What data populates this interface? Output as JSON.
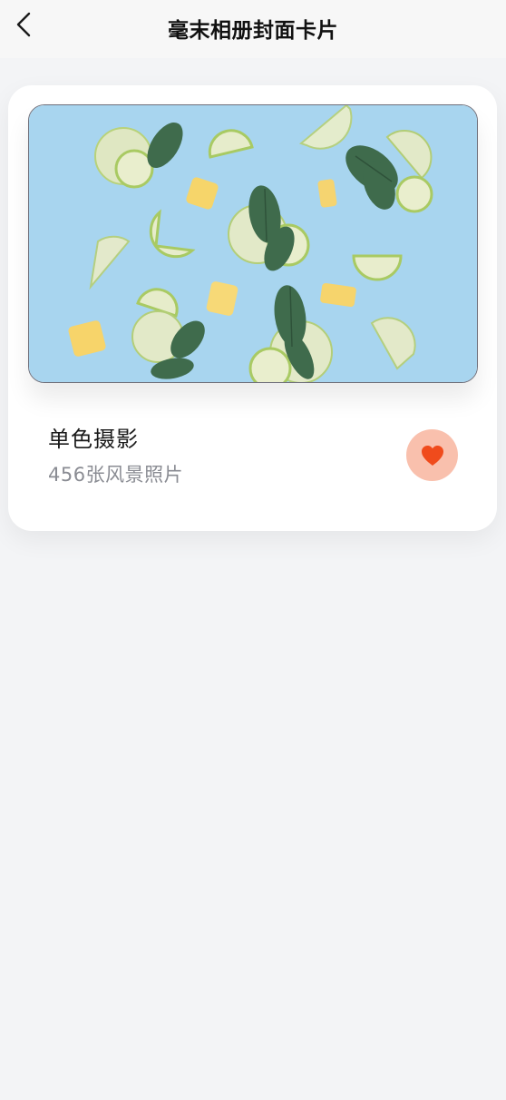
{
  "navbar": {
    "title": "毫末相册封面卡片",
    "back_icon": "chevron-left-icon"
  },
  "card": {
    "title": "单色摄影",
    "subtitle": "456张风景照片",
    "cover_image": "lime-and-mint-flatlay",
    "favorite_icon": "heart-icon",
    "colors": {
      "favorite_bg": "#f9c0ad",
      "favorite_heart": "#f04b1c",
      "cover_bg": "#a8d5ef"
    }
  }
}
